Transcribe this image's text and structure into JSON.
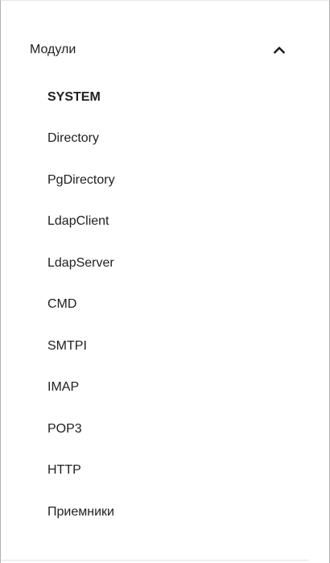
{
  "modules": {
    "title": "Модули",
    "expanded_icon": "chevron-up-icon",
    "items": [
      {
        "label": "SYSTEM"
      },
      {
        "label": "Directory"
      },
      {
        "label": "PgDirectory"
      },
      {
        "label": "LdapClient"
      },
      {
        "label": "LdapServer"
      },
      {
        "label": "CMD"
      },
      {
        "label": "SMTPI"
      },
      {
        "label": "IMAP"
      },
      {
        "label": "POP3"
      },
      {
        "label": "HTTP"
      },
      {
        "label": "Приемники"
      }
    ]
  }
}
